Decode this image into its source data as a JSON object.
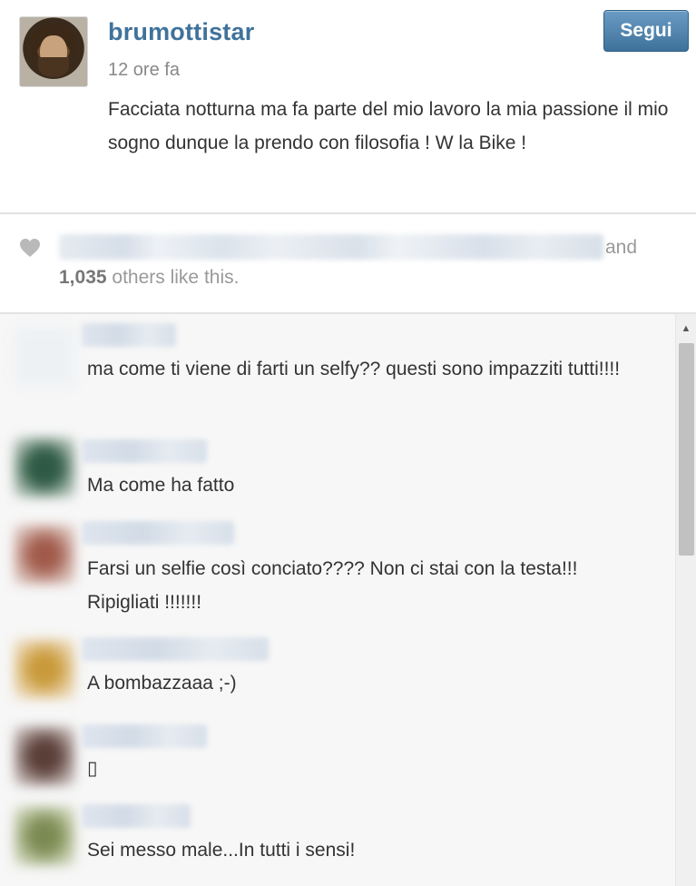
{
  "post": {
    "username": "brumottistar",
    "timestamp": "12 ore fa",
    "caption": "Facciata notturna ma fa parte del mio lavoro la mia passione il mio sogno dunque la prendo con filosofia ! W la Bike !",
    "follow_label": "Segui"
  },
  "likes": {
    "and_text": "and",
    "count": "1,035",
    "suffix": " others like this."
  },
  "comments": [
    {
      "text": "ma come ti viene di farti un selfy?? questi sono impazziti tutti!!!!"
    },
    {
      "text": "Ma come ha fatto"
    },
    {
      "text": "Farsi un selfie così conciato???? Non ci stai con la testa!!! Ripigliati !!!!!!!"
    },
    {
      "text": "A bombazzaaa ;-)"
    },
    {
      "text": "▯"
    },
    {
      "text": "Sei messo male...In tutti i sensi!"
    }
  ],
  "colors": {
    "username": "#3f729b",
    "follow_button": "#3f729b",
    "text": "#333333",
    "muted": "#999999",
    "comments_bg": "#f7f7f7"
  },
  "icons": {
    "like": "heart-icon",
    "scroll_up": "scroll-up-arrow-icon"
  }
}
